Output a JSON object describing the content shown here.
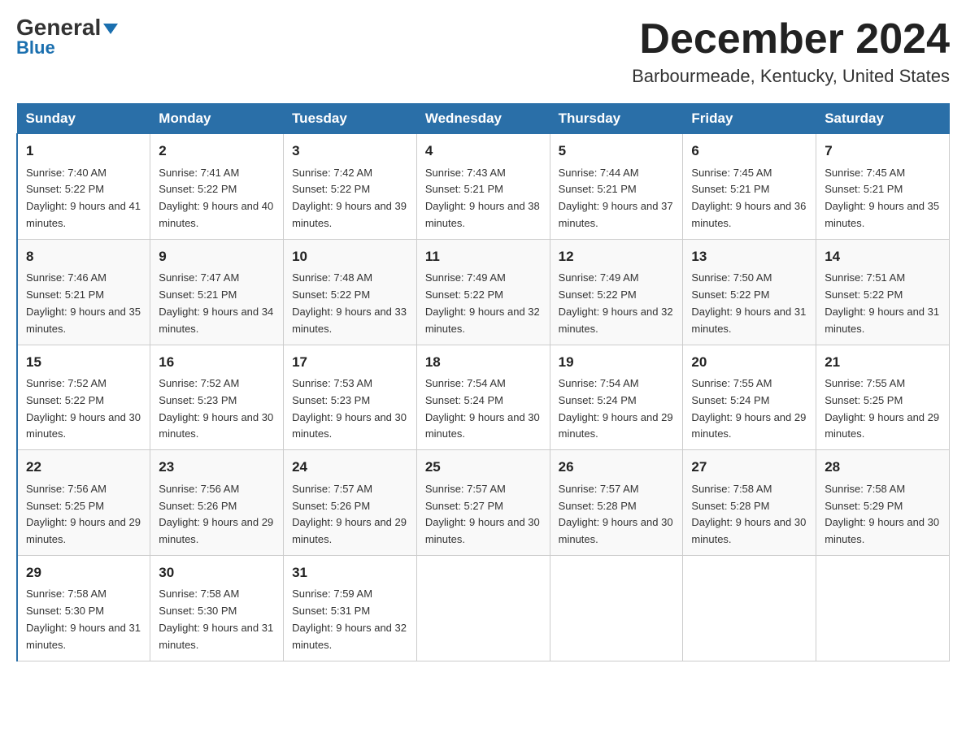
{
  "header": {
    "logo_line1": "General",
    "logo_line2": "Blue",
    "month_title": "December 2024",
    "location": "Barbourmeade, Kentucky, United States"
  },
  "days_of_week": [
    "Sunday",
    "Monday",
    "Tuesday",
    "Wednesday",
    "Thursday",
    "Friday",
    "Saturday"
  ],
  "weeks": [
    [
      {
        "day": "1",
        "sunrise": "7:40 AM",
        "sunset": "5:22 PM",
        "daylight": "9 hours and 41 minutes."
      },
      {
        "day": "2",
        "sunrise": "7:41 AM",
        "sunset": "5:22 PM",
        "daylight": "9 hours and 40 minutes."
      },
      {
        "day": "3",
        "sunrise": "7:42 AM",
        "sunset": "5:22 PM",
        "daylight": "9 hours and 39 minutes."
      },
      {
        "day": "4",
        "sunrise": "7:43 AM",
        "sunset": "5:21 PM",
        "daylight": "9 hours and 38 minutes."
      },
      {
        "day": "5",
        "sunrise": "7:44 AM",
        "sunset": "5:21 PM",
        "daylight": "9 hours and 37 minutes."
      },
      {
        "day": "6",
        "sunrise": "7:45 AM",
        "sunset": "5:21 PM",
        "daylight": "9 hours and 36 minutes."
      },
      {
        "day": "7",
        "sunrise": "7:45 AM",
        "sunset": "5:21 PM",
        "daylight": "9 hours and 35 minutes."
      }
    ],
    [
      {
        "day": "8",
        "sunrise": "7:46 AM",
        "sunset": "5:21 PM",
        "daylight": "9 hours and 35 minutes."
      },
      {
        "day": "9",
        "sunrise": "7:47 AM",
        "sunset": "5:21 PM",
        "daylight": "9 hours and 34 minutes."
      },
      {
        "day": "10",
        "sunrise": "7:48 AM",
        "sunset": "5:22 PM",
        "daylight": "9 hours and 33 minutes."
      },
      {
        "day": "11",
        "sunrise": "7:49 AM",
        "sunset": "5:22 PM",
        "daylight": "9 hours and 32 minutes."
      },
      {
        "day": "12",
        "sunrise": "7:49 AM",
        "sunset": "5:22 PM",
        "daylight": "9 hours and 32 minutes."
      },
      {
        "day": "13",
        "sunrise": "7:50 AM",
        "sunset": "5:22 PM",
        "daylight": "9 hours and 31 minutes."
      },
      {
        "day": "14",
        "sunrise": "7:51 AM",
        "sunset": "5:22 PM",
        "daylight": "9 hours and 31 minutes."
      }
    ],
    [
      {
        "day": "15",
        "sunrise": "7:52 AM",
        "sunset": "5:22 PM",
        "daylight": "9 hours and 30 minutes."
      },
      {
        "day": "16",
        "sunrise": "7:52 AM",
        "sunset": "5:23 PM",
        "daylight": "9 hours and 30 minutes."
      },
      {
        "day": "17",
        "sunrise": "7:53 AM",
        "sunset": "5:23 PM",
        "daylight": "9 hours and 30 minutes."
      },
      {
        "day": "18",
        "sunrise": "7:54 AM",
        "sunset": "5:24 PM",
        "daylight": "9 hours and 30 minutes."
      },
      {
        "day": "19",
        "sunrise": "7:54 AM",
        "sunset": "5:24 PM",
        "daylight": "9 hours and 29 minutes."
      },
      {
        "day": "20",
        "sunrise": "7:55 AM",
        "sunset": "5:24 PM",
        "daylight": "9 hours and 29 minutes."
      },
      {
        "day": "21",
        "sunrise": "7:55 AM",
        "sunset": "5:25 PM",
        "daylight": "9 hours and 29 minutes."
      }
    ],
    [
      {
        "day": "22",
        "sunrise": "7:56 AM",
        "sunset": "5:25 PM",
        "daylight": "9 hours and 29 minutes."
      },
      {
        "day": "23",
        "sunrise": "7:56 AM",
        "sunset": "5:26 PM",
        "daylight": "9 hours and 29 minutes."
      },
      {
        "day": "24",
        "sunrise": "7:57 AM",
        "sunset": "5:26 PM",
        "daylight": "9 hours and 29 minutes."
      },
      {
        "day": "25",
        "sunrise": "7:57 AM",
        "sunset": "5:27 PM",
        "daylight": "9 hours and 30 minutes."
      },
      {
        "day": "26",
        "sunrise": "7:57 AM",
        "sunset": "5:28 PM",
        "daylight": "9 hours and 30 minutes."
      },
      {
        "day": "27",
        "sunrise": "7:58 AM",
        "sunset": "5:28 PM",
        "daylight": "9 hours and 30 minutes."
      },
      {
        "day": "28",
        "sunrise": "7:58 AM",
        "sunset": "5:29 PM",
        "daylight": "9 hours and 30 minutes."
      }
    ],
    [
      {
        "day": "29",
        "sunrise": "7:58 AM",
        "sunset": "5:30 PM",
        "daylight": "9 hours and 31 minutes."
      },
      {
        "day": "30",
        "sunrise": "7:58 AM",
        "sunset": "5:30 PM",
        "daylight": "9 hours and 31 minutes."
      },
      {
        "day": "31",
        "sunrise": "7:59 AM",
        "sunset": "5:31 PM",
        "daylight": "9 hours and 32 minutes."
      },
      {
        "day": "",
        "sunrise": "",
        "sunset": "",
        "daylight": ""
      },
      {
        "day": "",
        "sunrise": "",
        "sunset": "",
        "daylight": ""
      },
      {
        "day": "",
        "sunrise": "",
        "sunset": "",
        "daylight": ""
      },
      {
        "day": "",
        "sunrise": "",
        "sunset": "",
        "daylight": ""
      }
    ]
  ],
  "labels": {
    "sunrise": "Sunrise: ",
    "sunset": "Sunset: ",
    "daylight": "Daylight: "
  }
}
